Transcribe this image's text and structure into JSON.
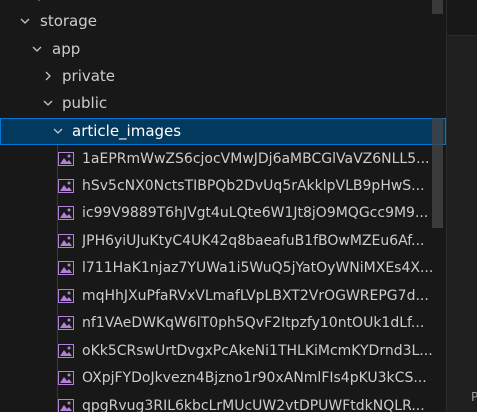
{
  "tree": {
    "storage": {
      "label": "storage"
    },
    "app": {
      "label": "app"
    },
    "private": {
      "label": "private"
    },
    "public": {
      "label": "public"
    },
    "article_images": {
      "label": "article_images"
    },
    "files": [
      "1aEPRmWwZS6cjocVMwJDj6aMBCGlVaVZ6NLL5...",
      "hSv5cNX0NctsTIBPQb2DvUq5rAkklpVLB9pHwS...",
      "ic99V9889T6hJVgt4uLQte6W1Jt8jO9MQGcc9M9...",
      "JPH6yiUJuKtyC4UK42q8baeafuB1fBOwMZEu6Af...",
      "l711HaK1njaz7YUWa1i5WuQ5jYatOyWNiMXEs4X...",
      "mqHhJXuPfaRVxVLmafLVpLBXT2VrOGWREPG7d...",
      "nf1VAeDWKqW6lT0ph5QvF2Itpzfy10ntOUk1dLf...",
      "oKk5CRswUrtDvgxPcAkeNi1THLKiMcmKYDrnd3L...",
      "OXpjFYDoJkvezn4Bjzno1r90xANmlFIs4pKU3kCS...",
      "qpgRvug3RIL6kbcLrMUcUW2vtDPUWFtdkNQLR..."
    ]
  },
  "right_pane": {
    "label": "P"
  },
  "colors": {
    "selection_bg": "#04395e",
    "selection_border": "#0078d4",
    "icon_purple": "#b180d7"
  }
}
